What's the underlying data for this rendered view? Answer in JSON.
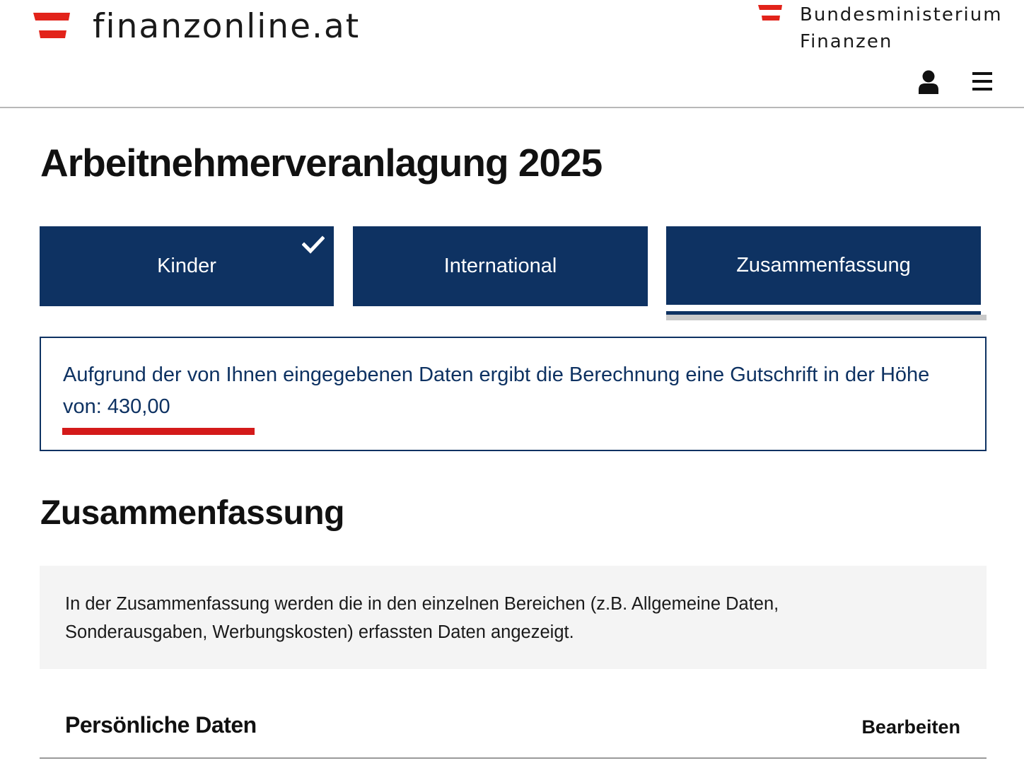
{
  "header": {
    "site_name": "finanzonline.at",
    "ministry_line1": "Bundesministerium",
    "ministry_line2": "Finanzen",
    "logo_icon": "austria-flag-icon",
    "user_icon": "user-icon",
    "menu_icon": "hamburger-menu-icon"
  },
  "page_title": "Arbeitnehmerveranlagung 2025",
  "steps": [
    {
      "label": "Kinder",
      "completed": true
    },
    {
      "label": "International",
      "completed": false
    },
    {
      "label": "Zusammenfassung",
      "active": true
    }
  ],
  "result": {
    "line1": "Aufgrund der von Ihnen eingegebenen Daten ergibt die Berechnung eine Gutschrift in der Höhe",
    "line2": "von: 430,00"
  },
  "section_title": "Zusammenfassung",
  "info": {
    "line1": "In der Zusammenfassung werden die in den einzelnen Bereichen (z.B. Allgemeine Daten,",
    "line2": "Sonderausgaben, Werbungskosten) erfassten Daten angezeigt."
  },
  "personal_data": {
    "title": "Persönliche Daten",
    "edit_label": "Bearbeiten"
  },
  "colors": {
    "primary_navy": "#0e3262",
    "austria_red": "#e2231a",
    "highlight_red": "#d41a1a",
    "info_bg": "#f4f4f4"
  }
}
